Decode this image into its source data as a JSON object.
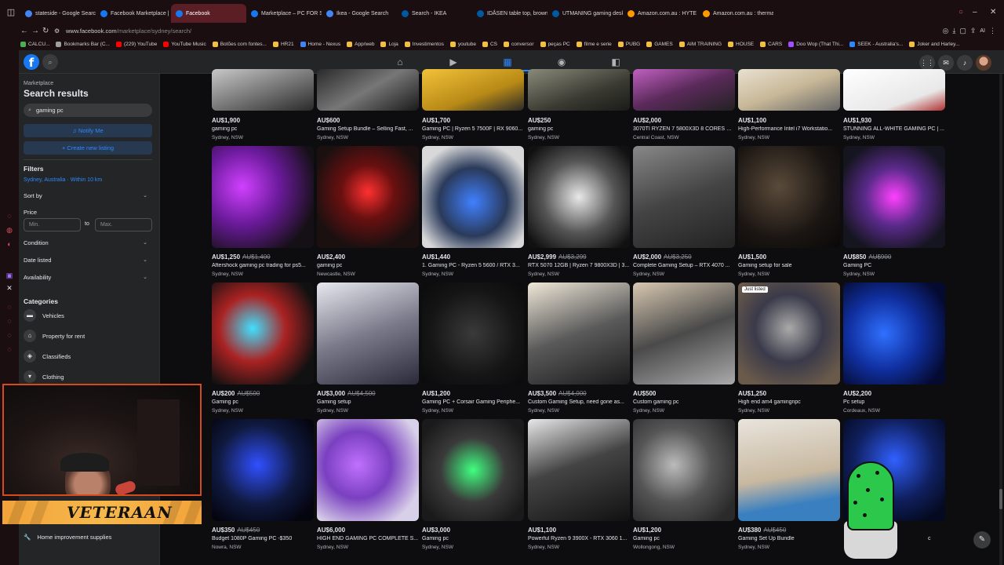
{
  "browser": {
    "tabs": [
      {
        "label": "stateside - Google Search",
        "color": "#4285f4",
        "active": false
      },
      {
        "label": "Facebook Marketplace | Fa",
        "color": "#1877f2",
        "active": false
      },
      {
        "label": "Facebook",
        "color": "#1877f2",
        "active": true
      },
      {
        "label": "Marketplace – PC FOR SA",
        "color": "#1877f2",
        "active": false
      },
      {
        "label": "Ikea - Google Search",
        "color": "#4285f4",
        "active": false
      },
      {
        "label": "Search - IKEA",
        "color": "#0058a3",
        "active": false
      },
      {
        "label": "IDÅSEN table top, brown, 1",
        "color": "#0058a3",
        "active": false
      },
      {
        "label": "UTMANING gaming desk w",
        "color": "#0058a3",
        "active": false
      },
      {
        "label": "Amazon.com.au : HYTE Ho",
        "color": "#ff9900",
        "active": false
      },
      {
        "label": "Amazon.com.au : thermalt",
        "color": "#ff9900",
        "active": false
      }
    ],
    "url_host": "www.facebook.com",
    "url_path": "/marketplace/sydney/search/",
    "bookmarks": [
      "CALCU...",
      "Bookmarks Bar (C...",
      "(229) YouTube",
      "YouTube Music",
      "Botões com fontes...",
      "HR21",
      "Home - Nexus",
      "App/web",
      "Loja",
      "Investimentos",
      "youtube",
      "CS",
      "conversor",
      "peças PC",
      "filme e serie",
      "PUBG",
      "GAMES",
      "AIM TRAINING",
      "HOUSE",
      "CARS",
      "Doo Wop (That Thi...",
      "SEEK - Australia's...",
      "Joker and Harley..."
    ]
  },
  "sidebar": {
    "section_label": "Marketplace",
    "title": "Search results",
    "search_value": "gaming pc",
    "notify_label": "Notify Me",
    "create_label": "Create new listing",
    "filters_heading": "Filters",
    "location": "Sydney, Australia · Within 10 km",
    "sort_by": "Sort by",
    "price_label": "Price",
    "min_placeholder": "Min.",
    "to_label": "to",
    "max_placeholder": "Max.",
    "condition": "Condition",
    "date_listed": "Date listed",
    "availability": "Availability",
    "categories_heading": "Categories",
    "categories": [
      "Vehicles",
      "Property for rent",
      "Classifieds",
      "Clothing"
    ],
    "bottom_category": "Home improvement supplies"
  },
  "overlay": {
    "banner_text": "VETERAAN"
  },
  "listings": [
    {
      "price": "AU$1,900",
      "old": "",
      "title": "gaming pc",
      "loc": "Sydney, NSW"
    },
    {
      "price": "AU$600",
      "old": "",
      "title": "Gaming Setup Bundle – Selling Fast, ...",
      "loc": "Sydney, NSW"
    },
    {
      "price": "AU$1,700",
      "old": "",
      "title": "Gaming PC | Ryzen 5 7500F | RX 9060...",
      "loc": "Sydney, NSW"
    },
    {
      "price": "AU$250",
      "old": "",
      "title": "gaming pc",
      "loc": "Sydney, NSW"
    },
    {
      "price": "AU$2,000",
      "old": "",
      "title": "3070TI RYZEN 7 5800X3D 8 CORES G...",
      "loc": "Central Coast, NSW"
    },
    {
      "price": "AU$1,100",
      "old": "",
      "title": "High-Performance Intel i7 Workstatio...",
      "loc": "Sydney, NSW"
    },
    {
      "price": "AU$1,930",
      "old": "",
      "title": "STUNNING ALL-WHITE GAMING PC | ...",
      "loc": "Sydney, NSW"
    },
    {
      "price": "AU$1,250",
      "old": "AU$1,400",
      "title": "Aftershock gaming pc trading for ps5...",
      "loc": "Sydney, NSW"
    },
    {
      "price": "AU$2,400",
      "old": "",
      "title": "gaming pc",
      "loc": "Newcastle, NSW"
    },
    {
      "price": "AU$1,440",
      "old": "",
      "title": "1. Gaming PC - Ryzen 5 5600 / RTX 3...",
      "loc": "Sydney, NSW"
    },
    {
      "price": "AU$2,999",
      "old": "AU$3,299",
      "title": "RTX 5070 12GB | Ryzen 7 9800X3D | 3...",
      "loc": "Sydney, NSW"
    },
    {
      "price": "AU$2,000",
      "old": "AU$3,250",
      "title": "Complete Gaming Setup – RTX 4070 ...",
      "loc": "Sydney, NSW"
    },
    {
      "price": "AU$1,500",
      "old": "",
      "title": "Gaming setup for sale",
      "loc": "Sydney, NSW"
    },
    {
      "price": "AU$850",
      "old": "AU$900",
      "title": "Gaming PC",
      "loc": "Sydney, NSW"
    },
    {
      "price": "AU$200",
      "old": "AU$500",
      "title": "Gaming pc",
      "loc": "Sydney, NSW"
    },
    {
      "price": "AU$3,000",
      "old": "AU$4,500",
      "title": "Gaming setup",
      "loc": "Sydney, NSW"
    },
    {
      "price": "AU$1,200",
      "old": "",
      "title": "Gaming PC + Corsair Gaming Periphe...",
      "loc": "Sydney, NSW"
    },
    {
      "price": "AU$3,500",
      "old": "AU$4,000",
      "title": "Custom Gaming Setup, need gone as...",
      "loc": "Sydney, NSW"
    },
    {
      "price": "AU$500",
      "old": "",
      "title": "Custom gaming pc",
      "loc": "Sydney, NSW"
    },
    {
      "price": "AU$1,250",
      "old": "",
      "title": "High end am4 gamingnpc",
      "loc": "Sydney, NSW",
      "badge": "Just listed"
    },
    {
      "price": "AU$2,200",
      "old": "",
      "title": "Pc setup",
      "loc": "Cordeaux, NSW"
    },
    {
      "price": "AU$350",
      "old": "AU$450",
      "title": "Budget 1080P Gaming PC -$350",
      "loc": "Nowra, NSW"
    },
    {
      "price": "AU$6,000",
      "old": "",
      "title": "HIGH END GAMING PC COMPLETE S...",
      "loc": "Sydney, NSW"
    },
    {
      "price": "AU$3,000",
      "old": "",
      "title": "Gaming pc",
      "loc": "Sydney, NSW"
    },
    {
      "price": "AU$1,100",
      "old": "",
      "title": "Powerful Ryzen 9 3900X - RTX 3060 1...",
      "loc": "Sydney, NSW"
    },
    {
      "price": "AU$1,200",
      "old": "",
      "title": "Gaming pc",
      "loc": "Wollongong, NSW"
    },
    {
      "price": "AU$380",
      "old": "AU$450",
      "title": "Gaming Set Up Bundle",
      "loc": "Sydney, NSW"
    },
    {
      "price": "",
      "old": "",
      "title": "c",
      "loc": ""
    }
  ],
  "colors": {
    "accent": "#2d88ff",
    "brand": "#1877f2",
    "background": "#18191a"
  }
}
